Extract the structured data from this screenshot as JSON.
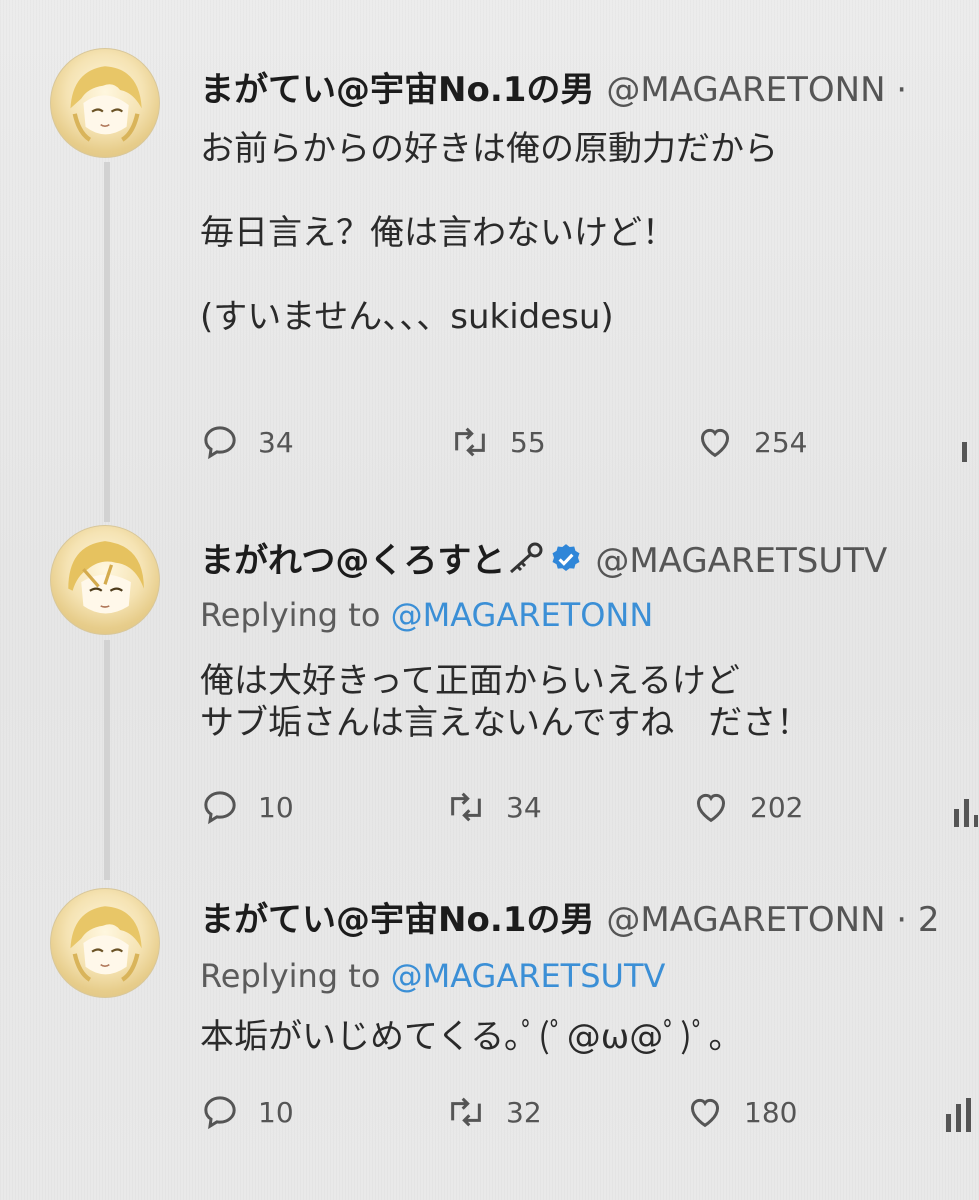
{
  "tweets": [
    {
      "display_name": "まがてい@宇宙No.1の男",
      "handle": "@MAGARETONN ·",
      "replying_prefix": "",
      "replying_to": "",
      "text": "お前らからの好きは俺の原動力だから\n\n毎日言え？俺は言わないけど！\n\n(すいません、、、sukidesu)",
      "replies": "34",
      "retweets": "55",
      "likes": "254"
    },
    {
      "display_name": "まがれつ@くろすと",
      "handle": "@MAGARETSUTV",
      "replying_prefix": "Replying to ",
      "replying_to": "@MAGARETONN",
      "text": "俺は大好きって正面からいえるけど\nサブ垢さんは言えないんですね　ださ！",
      "replies": "10",
      "retweets": "34",
      "likes": "202"
    },
    {
      "display_name": "まがてい@宇宙No.1の男",
      "handle": "@MAGARETONN · 2",
      "replying_prefix": "Replying to ",
      "replying_to": "@MAGARETSUTV",
      "text": "本垢がいじめてくる｡ﾟ(ﾟ@ω@ﾟ)ﾟ｡",
      "replies": "10",
      "retweets": "32",
      "likes": "180"
    }
  ],
  "colors": {
    "accent": "#3b8fd6",
    "verified": "#2f86d8",
    "text": "#2a2a2a",
    "muted": "#555555"
  },
  "icons": {
    "reply": "reply-icon",
    "retweet": "retweet-icon",
    "like": "heart-icon",
    "analytics": "analytics-icon",
    "verified": "verified-badge-icon",
    "key": "key-icon"
  }
}
